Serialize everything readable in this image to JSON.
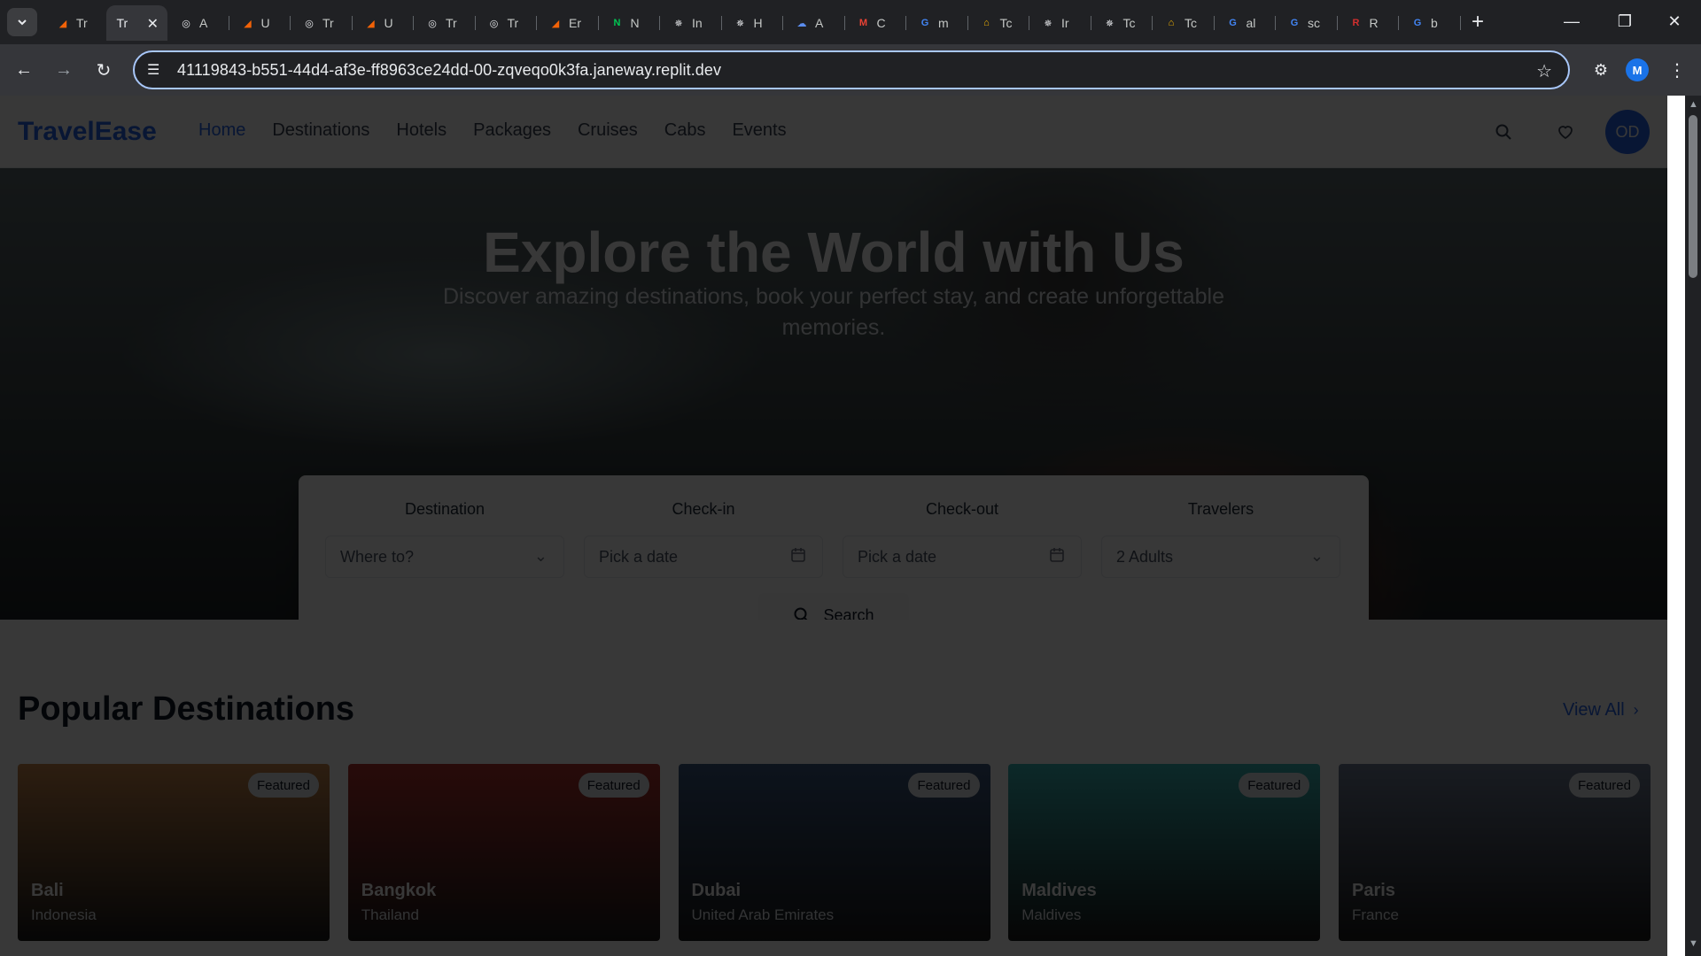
{
  "browser": {
    "tabs": [
      {
        "label": "Tr",
        "favicon": "replit-icon",
        "fav_color": "#f26207"
      },
      {
        "label": "Tr",
        "favicon": "none",
        "active": true
      },
      {
        "label": "A",
        "favicon": "globe-icon",
        "fav_color": "#e8eaed"
      },
      {
        "label": "U",
        "favicon": "replit-icon",
        "fav_color": "#f26207"
      },
      {
        "label": "Tr",
        "favicon": "globe-icon",
        "fav_color": "#e8eaed"
      },
      {
        "label": "U",
        "favicon": "replit-icon",
        "fav_color": "#f26207"
      },
      {
        "label": "Tr",
        "favicon": "globe-icon",
        "fav_color": "#e8eaed"
      },
      {
        "label": "Tr",
        "favicon": "globe-icon",
        "fav_color": "#e8eaed"
      },
      {
        "label": "Er",
        "favicon": "replit-icon",
        "fav_color": "#f26207"
      },
      {
        "label": "N",
        "favicon": "n-logo-icon",
        "fav_color": "#00c853"
      },
      {
        "label": "In",
        "favicon": "openai-icon",
        "fav_color": "#e8eaed"
      },
      {
        "label": "H",
        "favicon": "openai-icon",
        "fav_color": "#e8eaed"
      },
      {
        "label": "A",
        "favicon": "cloud-icon",
        "fav_color": "#5b8def"
      },
      {
        "label": "C",
        "favicon": "gmail-icon",
        "fav_color": "#ea4335"
      },
      {
        "label": "m",
        "favicon": "google-icon",
        "fav_color": "#4285f4"
      },
      {
        "label": "Tc",
        "favicon": "house-icon",
        "fav_color": "#f4b400"
      },
      {
        "label": "Ir",
        "favicon": "openai-icon",
        "fav_color": "#e8eaed"
      },
      {
        "label": "Tc",
        "favicon": "openai-icon",
        "fav_color": "#e8eaed"
      },
      {
        "label": "Tc",
        "favicon": "house-icon",
        "fav_color": "#f4b400"
      },
      {
        "label": "al",
        "favicon": "google-icon",
        "fav_color": "#4285f4"
      },
      {
        "label": "sc",
        "favicon": "google-icon",
        "fav_color": "#4285f4"
      },
      {
        "label": "R",
        "favicon": "r-logo-icon",
        "fav_color": "#d32f2f"
      },
      {
        "label": "b",
        "favicon": "google-icon",
        "fav_color": "#4285f4"
      }
    ],
    "url": "41119843-b551-44d4-af3e-ff8963ce24dd-00-zqveqo0k3fa.janeway.replit.dev",
    "profile_initial": "M",
    "profile_color": "#1a73e8"
  },
  "site": {
    "logo": "TravelEase",
    "nav": [
      "Home",
      "Destinations",
      "Hotels",
      "Packages",
      "Cruises",
      "Cabs",
      "Events"
    ],
    "active_nav": "Home",
    "avatar_initials": "OD",
    "accent": "#2563eb"
  },
  "hero": {
    "title": "Explore the World with Us",
    "subtitle": "Discover amazing destinations, book your perfect stay, and create unforgettable memories."
  },
  "search": {
    "fields": [
      {
        "label": "Destination",
        "value": "Where to?",
        "icon": "chevron-down-icon"
      },
      {
        "label": "Check-in",
        "value": "Pick a date",
        "icon": "calendar-icon"
      },
      {
        "label": "Check-out",
        "value": "Pick a date",
        "icon": "calendar-icon"
      },
      {
        "label": "Travelers",
        "value": "2 Adults",
        "icon": "chevron-down-icon"
      }
    ],
    "button_label": "Search"
  },
  "destinations": {
    "title": "Popular Destinations",
    "view_all": "View All",
    "items": [
      {
        "name": "Bali",
        "country": "Indonesia",
        "badge": "Featured",
        "bg": "#c9864a"
      },
      {
        "name": "Bangkok",
        "country": "Thailand",
        "badge": "Featured",
        "bg": "#b5342e"
      },
      {
        "name": "Dubai",
        "country": "United Arab Emirates",
        "badge": "Featured",
        "bg": "#3d5a82"
      },
      {
        "name": "Maldives",
        "country": "Maldives",
        "badge": "Featured",
        "bg": "#3ab8b8"
      },
      {
        "name": "Paris",
        "country": "France",
        "badge": "Featured",
        "bg": "#6f7d96"
      }
    ]
  }
}
